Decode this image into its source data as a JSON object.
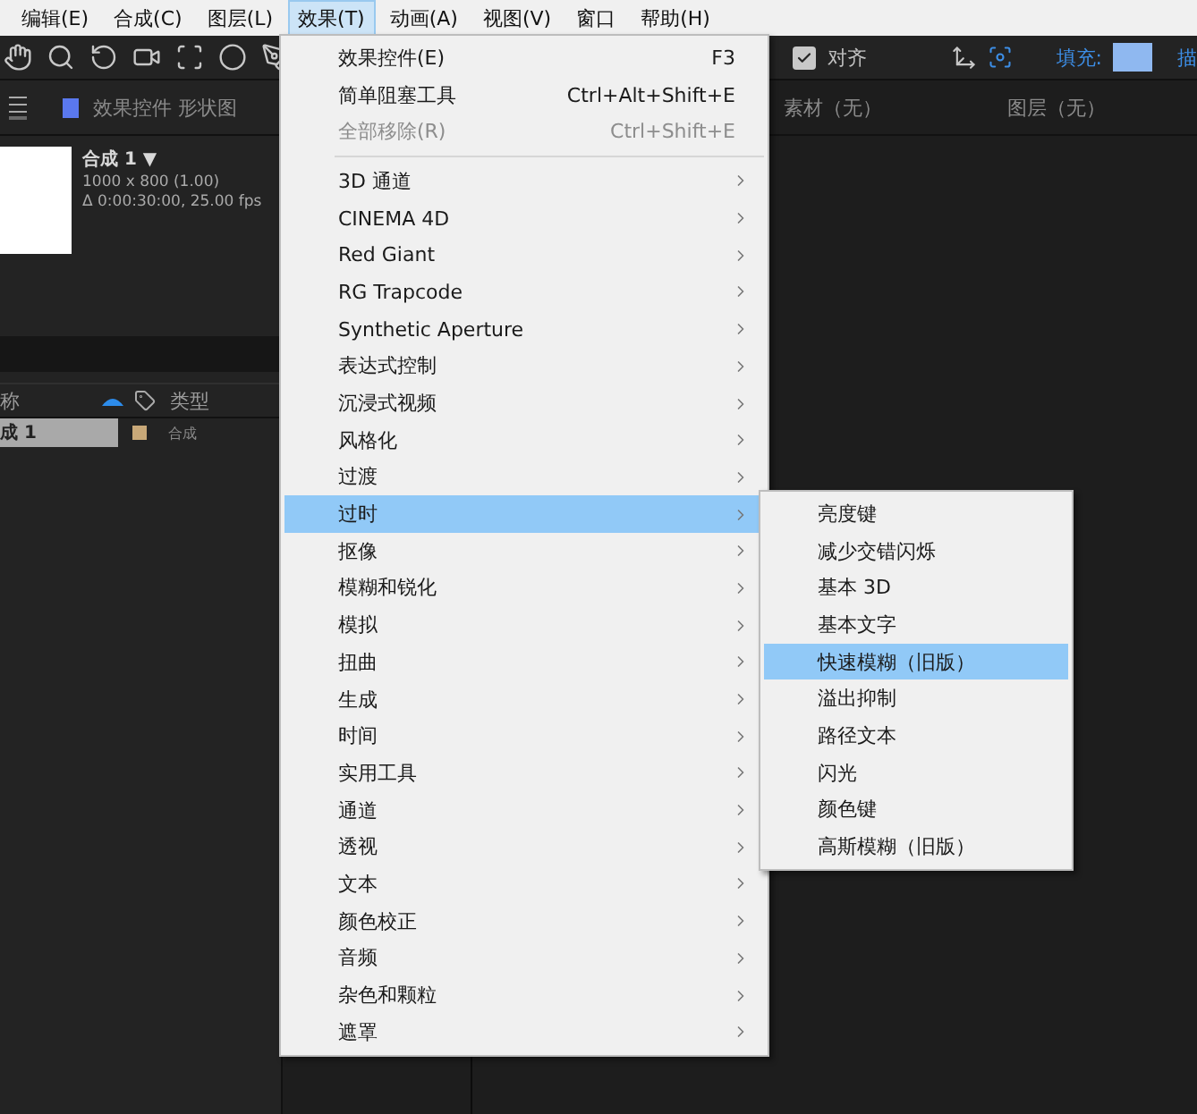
{
  "menubar": [
    {
      "label": "编辑(E)",
      "selected": false
    },
    {
      "label": "合成(C)",
      "selected": false
    },
    {
      "label": "图层(L)",
      "selected": false
    },
    {
      "label": "效果(T)",
      "selected": true
    },
    {
      "label": "动画(A)",
      "selected": false
    },
    {
      "label": "视图(V)",
      "selected": false
    },
    {
      "label": "窗口",
      "selected": false
    },
    {
      "label": "帮助(H)",
      "selected": false
    }
  ],
  "toolbar": {
    "snap": {
      "label": "对齐",
      "checked": true
    },
    "fill_label": "填充:",
    "stroke_label": "描"
  },
  "project_panel": {
    "tab": "效果控件 形状图",
    "comp_name": "合成 1 ▼",
    "size": "1000 x 800 (1.00)",
    "duration": "Δ 0:00:30:00, 25.00 fps",
    "columns": [
      "称",
      "类型"
    ],
    "rows": [
      {
        "name": "成 1",
        "type": "合成",
        "selected": true
      }
    ]
  },
  "viewer": {
    "tabs": [
      "素材（无）",
      "图层（无）"
    ]
  },
  "effects_menu": {
    "items": [
      {
        "kind": "command",
        "label": "效果控件(E)",
        "shortcut": "F3",
        "disabled": false,
        "selected": false
      },
      {
        "kind": "command",
        "label": "简单阻塞工具",
        "shortcut": "Ctrl+Alt+Shift+E",
        "disabled": false,
        "selected": false
      },
      {
        "kind": "command",
        "label": "全部移除(R)",
        "shortcut": "Ctrl+Shift+E",
        "disabled": true,
        "selected": false
      },
      {
        "kind": "separator"
      },
      {
        "kind": "submenu",
        "label": "3D 通道",
        "selected": false
      },
      {
        "kind": "submenu",
        "label": "CINEMA 4D",
        "selected": false
      },
      {
        "kind": "submenu",
        "label": "Red Giant",
        "selected": false
      },
      {
        "kind": "submenu",
        "label": "RG Trapcode",
        "selected": false
      },
      {
        "kind": "submenu",
        "label": "Synthetic Aperture",
        "selected": false
      },
      {
        "kind": "submenu",
        "label": "表达式控制",
        "selected": false
      },
      {
        "kind": "submenu",
        "label": "沉浸式视频",
        "selected": false
      },
      {
        "kind": "submenu",
        "label": "风格化",
        "selected": false
      },
      {
        "kind": "submenu",
        "label": "过渡",
        "selected": false
      },
      {
        "kind": "submenu",
        "label": "过时",
        "selected": true
      },
      {
        "kind": "submenu",
        "label": "抠像",
        "selected": false
      },
      {
        "kind": "submenu",
        "label": "模糊和锐化",
        "selected": false
      },
      {
        "kind": "submenu",
        "label": "模拟",
        "selected": false
      },
      {
        "kind": "submenu",
        "label": "扭曲",
        "selected": false
      },
      {
        "kind": "submenu",
        "label": "生成",
        "selected": false
      },
      {
        "kind": "submenu",
        "label": "时间",
        "selected": false
      },
      {
        "kind": "submenu",
        "label": "实用工具",
        "selected": false
      },
      {
        "kind": "submenu",
        "label": "通道",
        "selected": false
      },
      {
        "kind": "submenu",
        "label": "透视",
        "selected": false
      },
      {
        "kind": "submenu",
        "label": "文本",
        "selected": false
      },
      {
        "kind": "submenu",
        "label": "颜色校正",
        "selected": false
      },
      {
        "kind": "submenu",
        "label": "音频",
        "selected": false
      },
      {
        "kind": "submenu",
        "label": "杂色和颗粒",
        "selected": false
      },
      {
        "kind": "submenu",
        "label": "遮罩",
        "selected": false
      }
    ]
  },
  "obsolete_submenu": {
    "items": [
      {
        "label": "亮度键",
        "selected": false
      },
      {
        "label": "减少交错闪烁",
        "selected": false
      },
      {
        "label": "基本 3D",
        "selected": false
      },
      {
        "label": "基本文字",
        "selected": false
      },
      {
        "label": "快速模糊（旧版）",
        "selected": true
      },
      {
        "label": "溢出抑制",
        "selected": false
      },
      {
        "label": "路径文本",
        "selected": false
      },
      {
        "label": "闪光",
        "selected": false
      },
      {
        "label": "颜色键",
        "selected": false
      },
      {
        "label": "高斯模糊（旧版）",
        "selected": false
      }
    ]
  }
}
